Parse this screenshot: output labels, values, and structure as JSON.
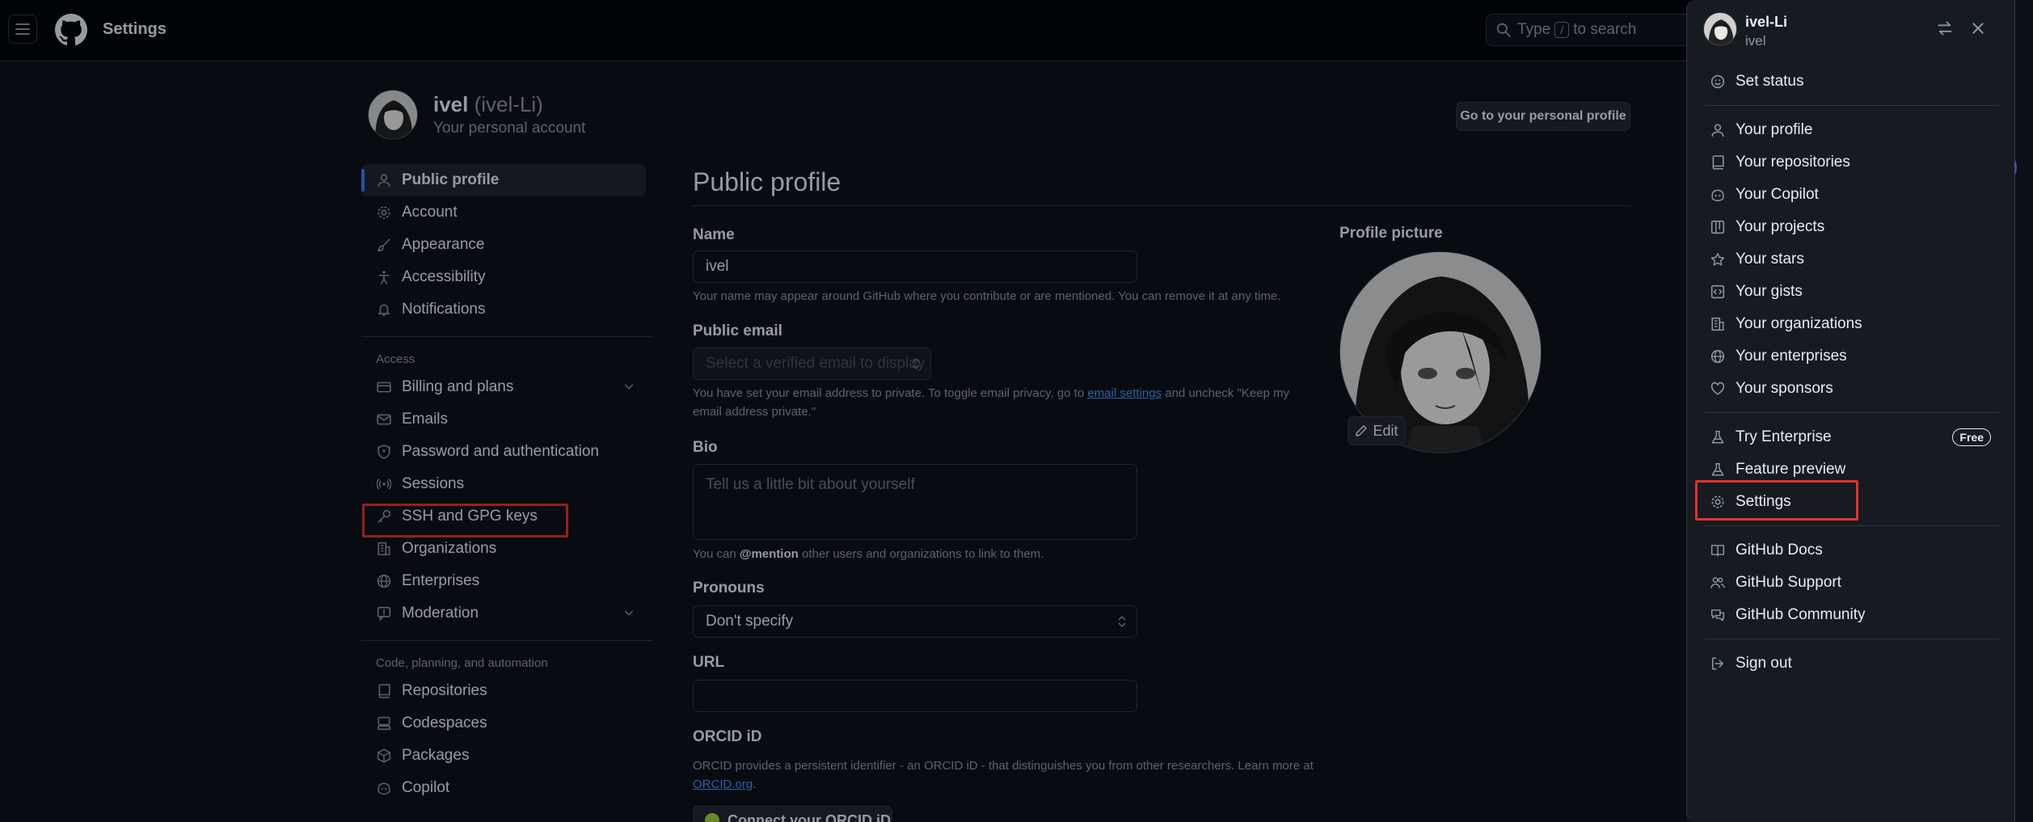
{
  "header": {
    "title": "Settings",
    "search": {
      "prefix": "Type",
      "slash": "/",
      "suffix": "to search"
    }
  },
  "account": {
    "name": "ivel",
    "login": "(ivel-Li)",
    "subtitle": "Your personal account",
    "profile_button": "Go to your personal profile"
  },
  "nav": {
    "top_items": [
      {
        "label": "Public profile",
        "icon": "person-icon",
        "active": true
      },
      {
        "label": "Account",
        "icon": "gear-icon"
      },
      {
        "label": "Appearance",
        "icon": "paintbrush-icon"
      },
      {
        "label": "Accessibility",
        "icon": "accessibility-icon"
      },
      {
        "label": "Notifications",
        "icon": "bell-icon"
      }
    ],
    "access_heading": "Access",
    "access_items": [
      {
        "label": "Billing and plans",
        "icon": "credit-card-icon",
        "expandable": true
      },
      {
        "label": "Emails",
        "icon": "mail-icon"
      },
      {
        "label": "Password and authentication",
        "icon": "shield-lock-icon"
      },
      {
        "label": "Sessions",
        "icon": "broadcast-icon"
      },
      {
        "label": "SSH and GPG keys",
        "icon": "key-icon",
        "highlighted": true
      },
      {
        "label": "Organizations",
        "icon": "organization-icon"
      },
      {
        "label": "Enterprises",
        "icon": "globe-icon"
      },
      {
        "label": "Moderation",
        "icon": "report-icon",
        "expandable": true
      }
    ],
    "code_heading": "Code, planning, and automation",
    "code_items": [
      {
        "label": "Repositories",
        "icon": "repo-icon"
      },
      {
        "label": "Codespaces",
        "icon": "codespaces-icon"
      },
      {
        "label": "Packages",
        "icon": "package-icon"
      },
      {
        "label": "Copilot",
        "icon": "copilot-icon"
      }
    ]
  },
  "form": {
    "title": "Public profile",
    "name_label": "Name",
    "name_value": "ivel",
    "name_note": "Your name may appear around GitHub where you contribute or are mentioned. You can remove it at any time.",
    "email_label": "Public email",
    "email_placeholder": "Select a verified email to display",
    "email_note_1": "You have set your email address to private. To toggle email privacy, go to",
    "email_note_link": "email settings",
    "email_note_2": "and uncheck \"Keep my email address private.\"",
    "bio_label": "Bio",
    "bio_placeholder": "Tell us a little bit about yourself",
    "bio_note_1": "You can",
    "bio_note_mention": "@mention",
    "bio_note_2": "other users and organizations to link to them.",
    "pronouns_label": "Pronouns",
    "pronouns_value": "Don't specify",
    "url_label": "URL",
    "url_value": "",
    "orcid_label": "ORCID iD",
    "orcid_note": "ORCID provides a persistent identifier - an ORCID iD - that distinguishes you from other researchers. Learn more at",
    "orcid_link": "ORCID.org",
    "orcid_note_end": ".",
    "orcid_button": "Connect your ORCID iD",
    "picture_label": "Profile picture",
    "edit_label": "Edit"
  },
  "panel": {
    "login": "ivel-Li",
    "name": "ivel",
    "groups": [
      [
        {
          "label": "Set status",
          "icon": "smiley-icon"
        }
      ],
      [
        {
          "label": "Your profile",
          "icon": "person-icon"
        },
        {
          "label": "Your repositories",
          "icon": "repo-icon"
        },
        {
          "label": "Your Copilot",
          "icon": "copilot-icon"
        },
        {
          "label": "Your projects",
          "icon": "table-icon"
        },
        {
          "label": "Your stars",
          "icon": "star-icon"
        },
        {
          "label": "Your gists",
          "icon": "code-square-icon"
        },
        {
          "label": "Your organizations",
          "icon": "organization-icon"
        },
        {
          "label": "Your enterprises",
          "icon": "globe-icon"
        },
        {
          "label": "Your sponsors",
          "icon": "heart-icon"
        }
      ],
      [
        {
          "label": "Try Enterprise",
          "icon": "beaker-icon",
          "badge": "Free"
        },
        {
          "label": "Feature preview",
          "icon": "beaker-icon"
        },
        {
          "label": "Settings",
          "icon": "gear-icon",
          "highlighted": true
        }
      ],
      [
        {
          "label": "GitHub Docs",
          "icon": "book-icon"
        },
        {
          "label": "GitHub Support",
          "icon": "people-icon"
        },
        {
          "label": "GitHub Community",
          "icon": "comment-discussion-icon"
        }
      ],
      [
        {
          "label": "Sign out",
          "icon": "sign-out-icon"
        }
      ]
    ]
  },
  "colors": {
    "background": "#0d1117",
    "accent": "#2f81f7",
    "highlight_box": "#e5302b",
    "link": "#4493f8"
  }
}
